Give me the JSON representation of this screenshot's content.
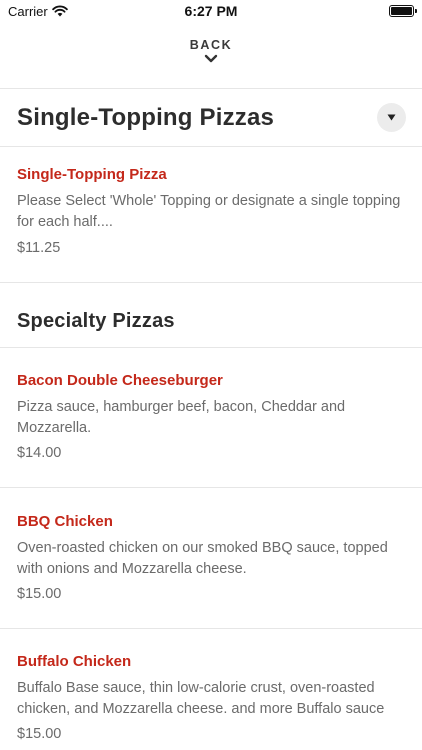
{
  "status_bar": {
    "carrier": "Carrier",
    "time": "6:27 PM",
    "battery_level": 1.0
  },
  "nav": {
    "back_label": "BACK",
    "back_icon": "chevron-down-icon"
  },
  "sections": [
    {
      "title": "Single-Topping Pizzas",
      "dropdown_icon": "triangle-down-icon",
      "items": [
        {
          "name": "Single-Topping Pizza",
          "description": "Please Select 'Whole' Topping or designate a single topping for each half....",
          "price": "$11.25"
        }
      ]
    },
    {
      "title": "Specialty Pizzas",
      "items": [
        {
          "name": "Bacon Double Cheeseburger",
          "description": "Pizza sauce, hamburger beef, bacon, Cheddar and Mozzarella.",
          "price": "$14.00"
        },
        {
          "name": "BBQ Chicken",
          "description": "Oven-roasted chicken on our smoked BBQ sauce, topped with onions and Mozzarella cheese.",
          "price": "$15.00"
        },
        {
          "name": "Buffalo Chicken",
          "description": "Buffalo Base sauce, thin low-calorie crust, oven-roasted chicken, and Mozzarella cheese. and more Buffalo sauce",
          "price": "$15.00"
        }
      ]
    }
  ],
  "colors": {
    "item_name": "#c4281a",
    "body_text": "#6b6b6b",
    "heading": "#2d2d2d",
    "divider": "#e6e6e6"
  }
}
